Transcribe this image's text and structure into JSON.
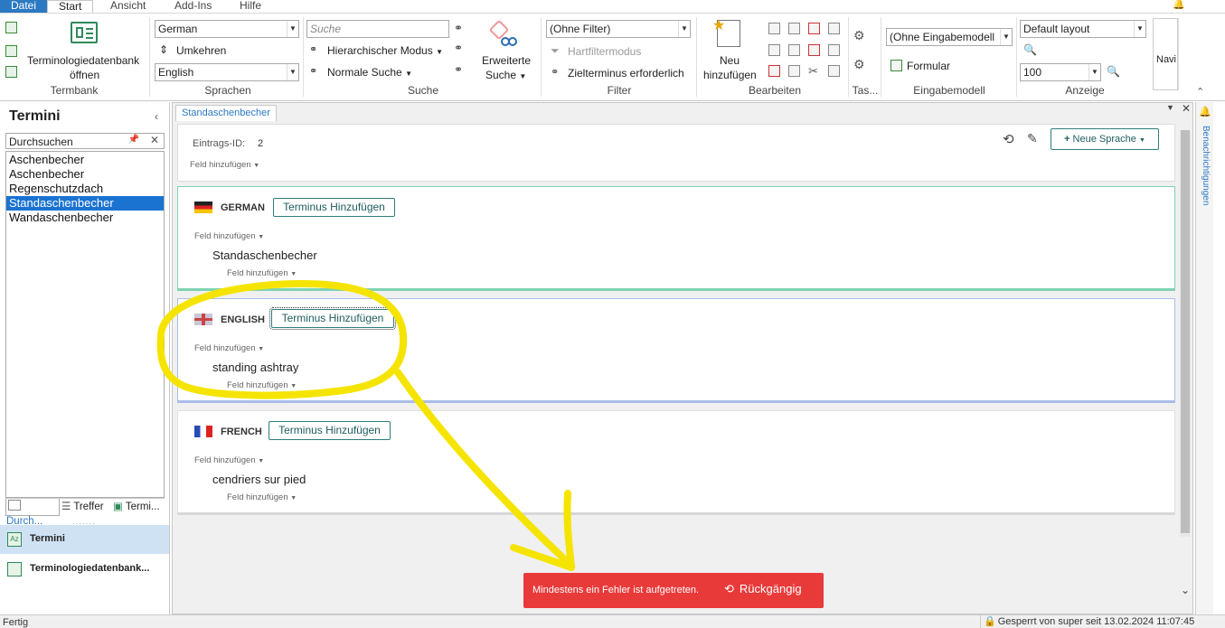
{
  "menu": {
    "file": "Datei",
    "tabs": [
      "Start",
      "Ansicht",
      "Add-Ins",
      "Hilfe"
    ]
  },
  "ribbon": {
    "termbank": {
      "open_label_1": "Terminologiedatenbank",
      "open_label_2": "öffnen",
      "group": "Termbank"
    },
    "languages": {
      "source": "German",
      "reverse": "Umkehren",
      "target": "English",
      "group": "Sprachen"
    },
    "search": {
      "placeholder": "Suche",
      "hier_mode": "Hierarchischer Modus",
      "normal_search": "Normale Suche",
      "extended_1": "Erweiterte",
      "extended_2": "Suche",
      "group": "Suche"
    },
    "filter": {
      "value": "(Ohne Filter)",
      "hard_filter": "Hartfiltermodus",
      "target_required": "Zielterminus erforderlich",
      "group": "Filter"
    },
    "edit": {
      "new_1": "Neu",
      "new_2": "hinzufügen",
      "group": "Bearbeiten"
    },
    "tasks": {
      "group": "Tas..."
    },
    "input_model": {
      "value": "(Ohne Eingabemodell",
      "form": "Formular",
      "group": "Eingabemodell"
    },
    "view": {
      "layout": "Default layout",
      "zoom": "100",
      "group": "Anzeige"
    },
    "navi": "Navi"
  },
  "left_panel": {
    "title": "Termini",
    "search_value": "Durchsuchen",
    "terms": [
      "Aschenbecher",
      "Aschenbecher",
      "Regenschutzdach",
      "Standaschenbecher",
      "Wandaschenbecher"
    ],
    "selected_index": 3,
    "bottom_tabs": [
      "Durch...",
      "Treffer",
      "Termi..."
    ],
    "nav": [
      "Termini",
      "Terminologiedatenbank..."
    ]
  },
  "document_tab": "Standaschenbecher",
  "entry": {
    "id_label": "Eintrags-ID:",
    "id_value": "2",
    "field_add": "Feld hinzufügen",
    "new_language": "Neue Sprache",
    "add_term": "Terminus Hinzufügen",
    "languages": [
      {
        "name": "GERMAN",
        "term": "Standaschenbecher",
        "accent": "#7fd3b0"
      },
      {
        "name": "ENGLISH",
        "term": "standing ashtray",
        "accent": "#a9bde8"
      },
      {
        "name": "FRENCH",
        "term": "cendriers sur pied",
        "accent": "#d8d8d8"
      }
    ]
  },
  "notifications_label": "Benachrichtigungen",
  "toast": {
    "message": "Mindestens ein Fehler ist aufgetreten.",
    "undo": "Rückgängig"
  },
  "status": {
    "left": "Fertig",
    "right": "Gesperrt von super seit 13.02.2024 11:07:45"
  },
  "colors": {
    "accent": "#2b79c2",
    "selection": "#1a73d1",
    "toast": "#e93a3a",
    "highlight": "#f5e400"
  }
}
